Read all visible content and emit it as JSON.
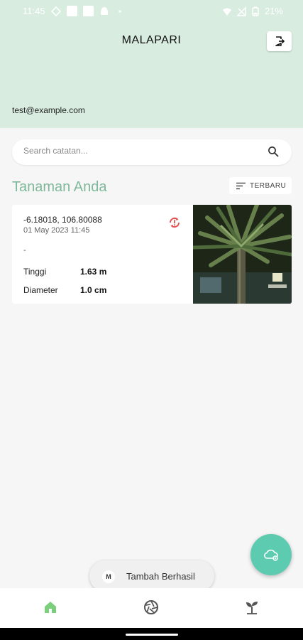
{
  "status_bar": {
    "time": "11:45",
    "battery": "21%"
  },
  "header": {
    "title": "MALAPARI",
    "email": "test@example.com"
  },
  "search": {
    "placeholder": "Search catatan..."
  },
  "section": {
    "title": "Tanaman Anda",
    "sort_label": "TERBARU"
  },
  "records": [
    {
      "coords": "-6.18018, 106.80088",
      "datetime": "01 May 2023 11:45",
      "note": "-",
      "height_label": "Tinggi",
      "height_value": "1.63 m",
      "diameter_label": "Diameter",
      "diameter_value": "1.0 cm"
    }
  ],
  "toast": {
    "avatar": "M",
    "text": "Tambah Berhasil"
  },
  "icons": {
    "logout": "logout-icon",
    "search": "search-icon",
    "sort": "sort-icon",
    "sync": "sync-error-icon",
    "fab": "cloud-upload-icon",
    "nav": [
      "home-icon",
      "camera-shutter-icon",
      "plant-sprout-icon"
    ]
  },
  "colors": {
    "header_bg": "#d8ece0",
    "accent": "#7fb89a",
    "fab": "#5ccbb0",
    "sync_error": "#e05050",
    "nav_active": "#7ccf7a"
  }
}
